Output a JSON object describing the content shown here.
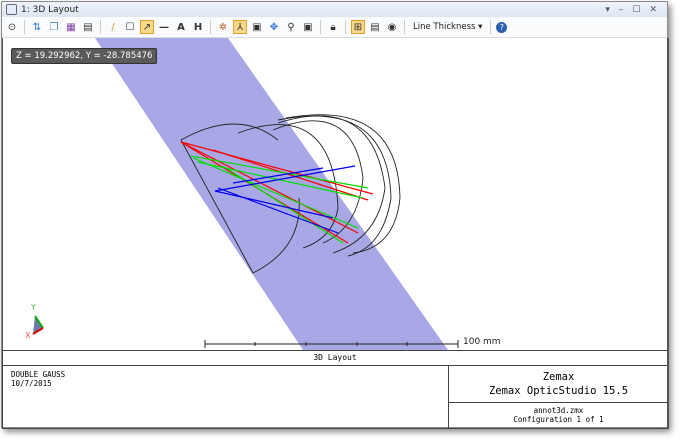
{
  "window": {
    "title": "1: 3D Layout",
    "controls": [
      "▾",
      "–",
      "☐",
      "✕"
    ]
  },
  "toolbar": {
    "line_thickness": "Line Thickness ▾"
  },
  "readout": "Z = 19.292962, Y = -28.785476",
  "scale": {
    "label": "100 mm"
  },
  "colors": {
    "beam": "#a3a3e6",
    "ray1": "#ff0000",
    "ray2": "#00dd00",
    "ray3": "#0000ee"
  },
  "axes": {
    "y": "Y",
    "x": "X"
  },
  "footer": {
    "title": "3D Layout",
    "lens": "DOUBLE GAUSS",
    "date": "10/7/2015",
    "company": "Zemax",
    "product": "Zemax OpticStudio 15.5",
    "file": "annot3d.zmx",
    "config": "Configuration 1 of 1"
  }
}
